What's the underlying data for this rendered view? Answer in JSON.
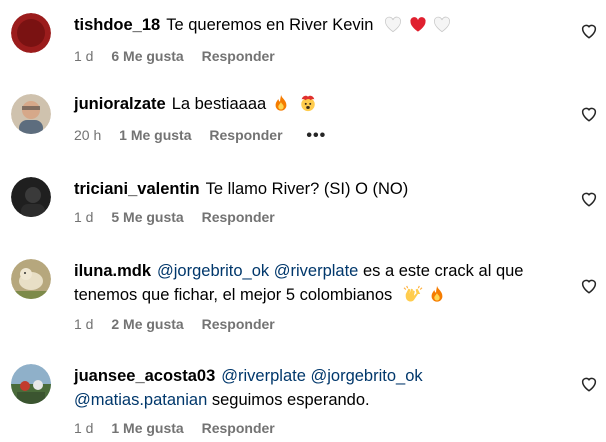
{
  "comments": [
    {
      "username": "tishdoe_18",
      "text": "Te queremos en River Kevin",
      "emojis": [
        "white-heart-icon",
        "red-heart-icon",
        "white-heart-icon"
      ],
      "time": "1 d",
      "likes": "6 Me gusta",
      "reply": "Responder",
      "avatar_color": "#9b1c1c"
    },
    {
      "username": "junioralzate",
      "text": "La bestiaaaa",
      "emojis": [
        "fire-icon",
        "exploding-head-icon"
      ],
      "time": "20 h",
      "likes": "1 Me gusta",
      "reply": "Responder",
      "more": "•••",
      "avatar_color": "#b8a48c"
    },
    {
      "username": "triciani_valentin",
      "text": "Te llamo River? (SI) O (NO)",
      "emojis": [],
      "time": "1 d",
      "likes": "5 Me gusta",
      "reply": "Responder",
      "avatar_color": "#1f1f1f"
    },
    {
      "username": "iluna.mdk",
      "mention1": "@jorgebrito_ok",
      "mention2": "@riverplate",
      "text_line1": "es a este crack al que",
      "text_line2": "tenemos que fichar, el mejor 5 colombianos",
      "emojis": [
        "raising-hands-icon",
        "fire-icon"
      ],
      "time": "1 d",
      "likes": "2 Me gusta",
      "reply": "Responder",
      "avatar_color": "#c9b48a"
    },
    {
      "username": "juansee_acosta03",
      "mention1": "@riverplate",
      "mention2": "@jorgebrito_ok",
      "mention3": "@matias.patanian",
      "text_line2": "seguimos esperando.",
      "time": "1 d",
      "likes": "1 Me gusta",
      "reply": "Responder",
      "avatar_color": "#4a6b3a"
    }
  ],
  "colors": {
    "mention": "#00376b",
    "meta": "#737373",
    "heart_red": "#ff3040"
  }
}
